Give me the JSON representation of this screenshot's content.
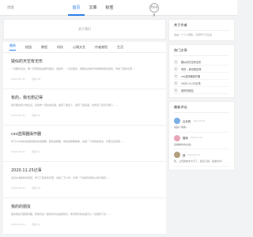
{
  "header": {
    "logo": "博客",
    "nav": [
      "首页",
      "文章",
      "标签"
    ],
    "login": "登录/注册"
  },
  "banner": {
    "text": "关于我们"
  },
  "tabs": [
    "最新",
    "校园",
    "教程",
    "科技",
    "心情文艺",
    "作者感悟",
    "生活"
  ],
  "posts": [
    {
      "title": "疑似的天空有无形",
      "excerpt": "一切都将远去，唯一有意思的是那份美好。这些年，一点点变好，我都在这些年中慢慢地成长起来，学会了很多东西……",
      "date": "2022-04-16",
      "views": "阅读 34"
    },
    {
      "title": "有的，我也想記得",
      "excerpt": "我们都在努力地生活，就这样一直往前走着，遇到了很多人，经历了很多事，也学会了原谅与放下……",
      "date": "2022-04-16",
      "views": "阅读 26"
    },
    {
      "title": "css选择器操作器",
      "excerpt": "学习CSS的时候遇到很多的选择器，属性选择器、伪类选择器等等，总结一下常用的用法，方便日后查阅……",
      "date": "2022-04-16",
      "views": "阅读 41"
    },
    {
      "title": "2020.11.25记事",
      "excerpt": "最近在准备新的项目，学习了很多新东西，也踩了不少坑，记录一下这段时间的心得与收获……",
      "date": "2022-04-16",
      "views": "阅读 19"
    },
    {
      "title": "我的的朋友",
      "excerpt": "我的朋友们都很有趣，和他们在一起的时光总是很快乐，希望我们的友谊可以一直保持下去……",
      "date": "2022-04-16",
      "views": "阅读 22"
    }
  ],
  "sidebar": {
    "about": {
      "title": "关于作者",
      "text": "这是一个个人博客，记录学习与生活"
    },
    "hot": {
      "title": "热门文章",
      "items": [
        "疑似的天空有无形",
        "有的，我也想記得",
        "css选择器操作器",
        "2020.11.25记事",
        "我的的朋友"
      ]
    },
    "comments": {
      "title": "最新评论",
      "items": [
        {
          "name": "云月亮",
          "time": "2022-04-16",
          "text": "来踩个博客~",
          "color": "#7ab0e6"
        },
        {
          "name": "猫咪",
          "time": "2022-04-16",
          "text": "来看看你的文章~",
          "color": "#e8a5b8"
        },
        {
          "name": "我",
          "time": "2022-04-16",
          "text": "哇，上传的技术大不了，建议几篇，感谢分享！",
          "color": "#b3a07f"
        }
      ]
    }
  }
}
